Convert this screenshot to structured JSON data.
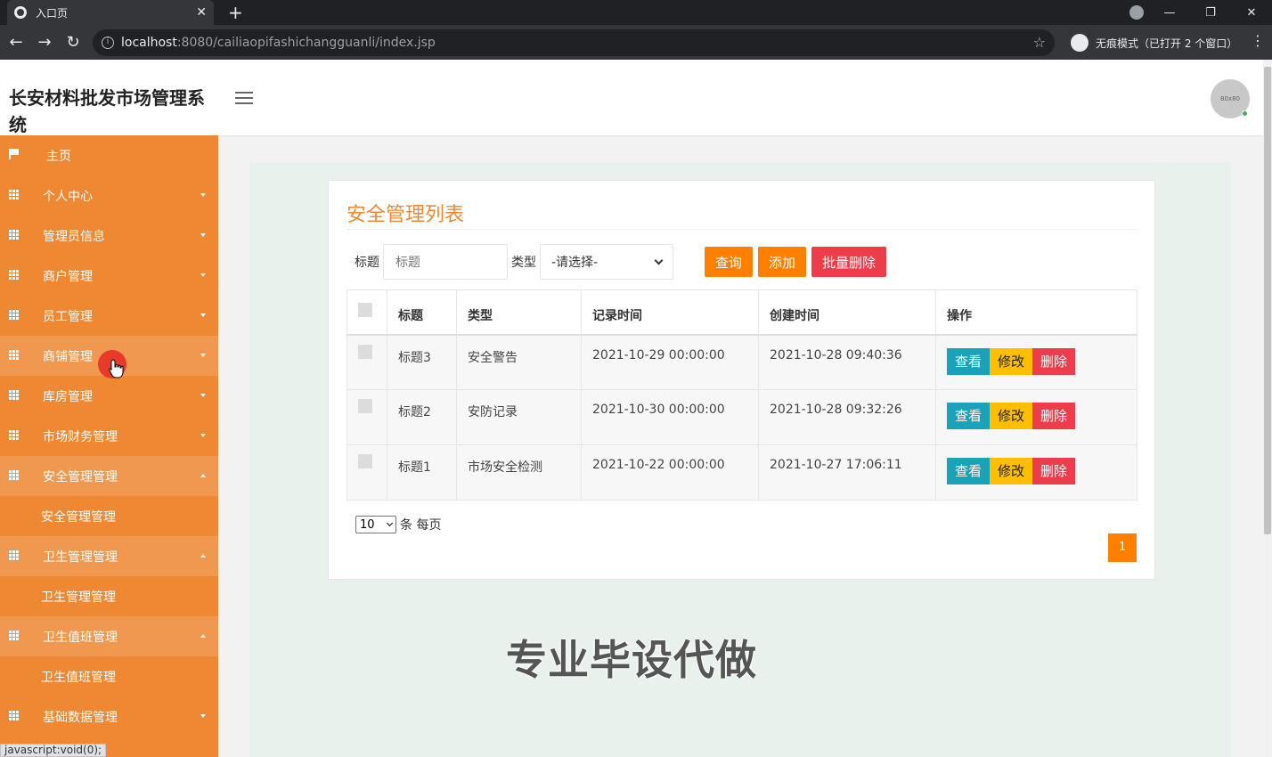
{
  "browser": {
    "tab_title": "入口页",
    "tab_close": "✕",
    "new_tab": "+",
    "window_controls": [
      "—",
      "❐",
      "✕"
    ],
    "back": "←",
    "forward": "→",
    "reload": "↻",
    "url_host": "localhost",
    "url_rest": ":8080/cailiaopifashichangguanli/index.jsp",
    "info_icon": "i",
    "star": "☆",
    "incognito_label": "无痕模式（已打开 2 个窗口）",
    "menu": "⋮"
  },
  "header": {
    "system_title": "长安材料批发市场管理系统",
    "avatar_text": "80x80"
  },
  "sidebar": {
    "home": "主页",
    "items": [
      {
        "label": "个人中心"
      },
      {
        "label": "管理员信息"
      },
      {
        "label": "商户管理"
      },
      {
        "label": "员工管理"
      },
      {
        "label": "商铺管理"
      },
      {
        "label": "库房管理"
      },
      {
        "label": "市场财务管理"
      },
      {
        "label": "安全管理管理"
      },
      {
        "label": "卫生管理管理"
      },
      {
        "label": "卫生值班管理"
      },
      {
        "label": "基础数据管理"
      }
    ],
    "subs": {
      "security": "安全管理管理",
      "hygiene": "卫生管理管理",
      "duty": "卫生值班管理"
    }
  },
  "main": {
    "title": "安全管理列表",
    "filter_title_label": "标题",
    "filter_title_placeholder": "标题",
    "filter_type_label": "类型",
    "filter_type_value": "-请选择-",
    "btn_search": "查询",
    "btn_add": "添加",
    "btn_batch_delete": "批量删除",
    "columns": [
      "标题",
      "类型",
      "记录时间",
      "创建时间",
      "操作"
    ],
    "rows": [
      {
        "title": "标题3",
        "type": "安全警告",
        "record_time": "2021-10-29 00:00:00",
        "create_time": "2021-10-28 09:40:36"
      },
      {
        "title": "标题2",
        "type": "安防记录",
        "record_time": "2021-10-30 00:00:00",
        "create_time": "2021-10-28 09:32:26"
      },
      {
        "title": "标题1",
        "type": "市场安全检测",
        "record_time": "2021-10-22 00:00:00",
        "create_time": "2021-10-27 17:06:11"
      }
    ],
    "op_view": "查看",
    "op_edit": "修改",
    "op_delete": "删除",
    "page_size": "10",
    "page_size_suffix": "条 每页",
    "current_page": "1"
  },
  "watermark": "专业毕设代做",
  "status_url": "javascript:void(0);",
  "colors": {
    "sidebar": "#ee8833",
    "accent": "#ff7f00",
    "danger": "#ee3d4a",
    "info": "#1aa3b8",
    "warning": "#ffbe00"
  }
}
